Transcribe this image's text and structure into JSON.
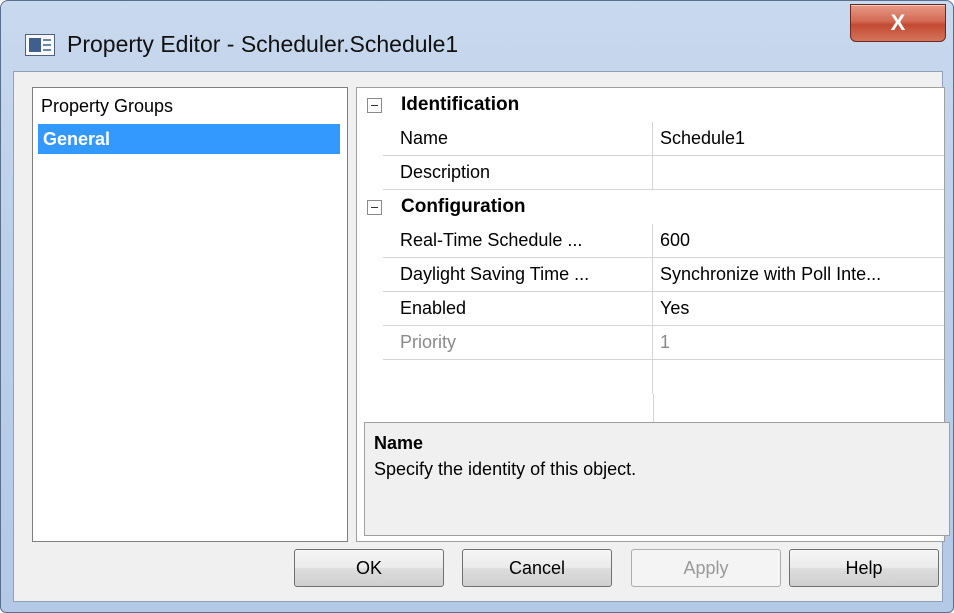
{
  "window": {
    "title": "Property Editor - Scheduler.Schedule1",
    "close_label": "X",
    "icon": "property-editor-icon"
  },
  "groups": {
    "header": "Property Groups",
    "items": [
      "General"
    ],
    "selected": "General"
  },
  "properties": {
    "categories": [
      {
        "label": "Identification",
        "toggle": "collapse",
        "rows": [
          {
            "name": "Name",
            "value": "Schedule1"
          },
          {
            "name": "Description",
            "value": ""
          }
        ]
      },
      {
        "label": "Configuration",
        "toggle": "collapse",
        "rows": [
          {
            "name": "Real-Time Schedule ...",
            "value": "600"
          },
          {
            "name": "Daylight Saving Time ...",
            "value": "Synchronize with Poll Inte..."
          },
          {
            "name": "Enabled",
            "value": "Yes"
          },
          {
            "name": "Priority",
            "value": "1"
          }
        ]
      }
    ]
  },
  "help_panel": {
    "title": "Name",
    "text": "Specify the identity of this object."
  },
  "buttons": {
    "ok": "OK",
    "cancel": "Cancel",
    "apply": "Apply",
    "help": "Help"
  },
  "colors": {
    "selection": "#3399ff",
    "close_button": "#c24a32",
    "disabled_text": "#8a8a8a"
  }
}
